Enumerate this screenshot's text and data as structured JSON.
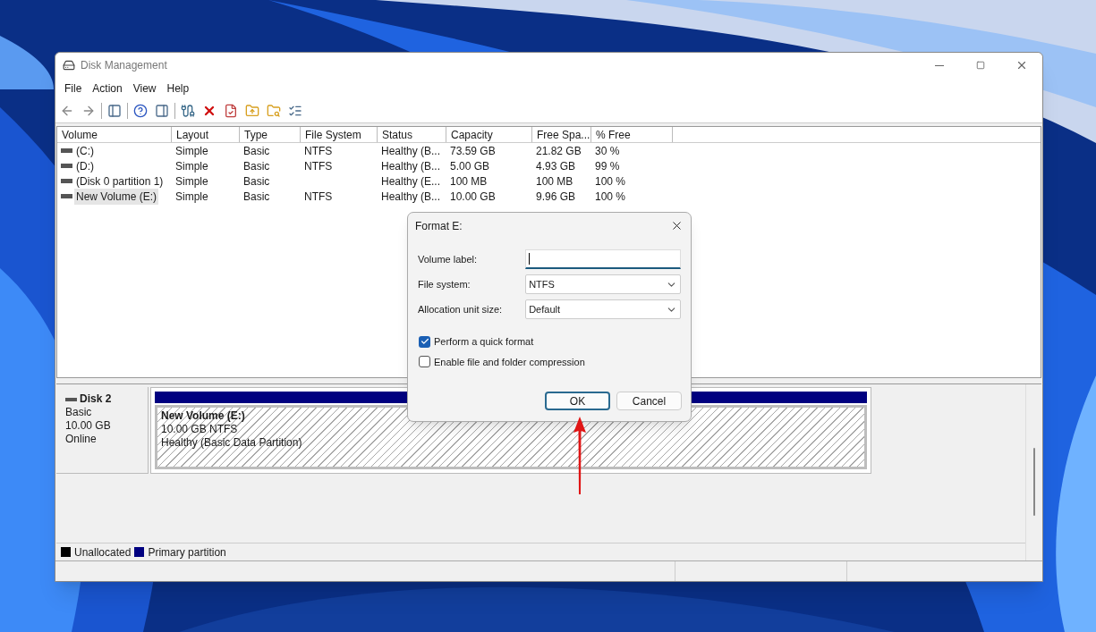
{
  "window": {
    "title": "Disk Management"
  },
  "menu": [
    "File",
    "Action",
    "View",
    "Help"
  ],
  "volume_table": {
    "columns": [
      "Volume",
      "Layout",
      "Type",
      "File System",
      "Status",
      "Capacity",
      "Free Spa...",
      "% Free"
    ],
    "rows": [
      {
        "volume": "(C:)",
        "layout": "Simple",
        "type": "Basic",
        "file_system": "NTFS",
        "status": "Healthy (B...",
        "capacity": "73.59 GB",
        "free_space": "21.82 GB",
        "percent_free": "30 %",
        "selected": false
      },
      {
        "volume": "(D:)",
        "layout": "Simple",
        "type": "Basic",
        "file_system": "NTFS",
        "status": "Healthy (B...",
        "capacity": "5.00 GB",
        "free_space": "4.93 GB",
        "percent_free": "99 %",
        "selected": false
      },
      {
        "volume": "(Disk 0 partition 1)",
        "layout": "Simple",
        "type": "Basic",
        "status": "Healthy (E...",
        "capacity": "100 MB",
        "free_space": "100 MB",
        "percent_free": "100 %",
        "selected": false
      },
      {
        "volume": "New Volume (E:)",
        "layout": "Simple",
        "type": "Basic",
        "file_system": "NTFS",
        "status": "Healthy (B...",
        "capacity": "10.00 GB",
        "free_space": "9.96 GB",
        "percent_free": "100 %",
        "selected": true
      }
    ]
  },
  "disk": {
    "name": "Disk 2",
    "type": "Basic",
    "size": "10.00 GB",
    "status": "Online",
    "partitions": [
      {
        "name": "New Volume  (E:)",
        "detail": "10.00 GB NTFS",
        "status": "Healthy (Basic Data Partition)",
        "color": "#000080",
        "selected": true
      }
    ]
  },
  "legend": [
    {
      "label": "Unallocated",
      "color": "#000000"
    },
    {
      "label": "Primary partition",
      "color": "#000080"
    }
  ],
  "dialog": {
    "title": "Format E:",
    "fields": [
      {
        "kind": "text",
        "label": "Volume label:",
        "focused": true
      },
      {
        "kind": "select",
        "label": "File system:",
        "value": "NTFS"
      },
      {
        "kind": "select",
        "label": "Allocation unit size:",
        "value": "Default"
      }
    ],
    "options": [
      {
        "label": "Perform a quick format",
        "checked": true
      },
      {
        "label": "Enable file and folder compression",
        "checked": false
      }
    ],
    "buttons": [
      {
        "label": "OK",
        "default": true
      },
      {
        "label": "Cancel",
        "default": false
      }
    ]
  }
}
